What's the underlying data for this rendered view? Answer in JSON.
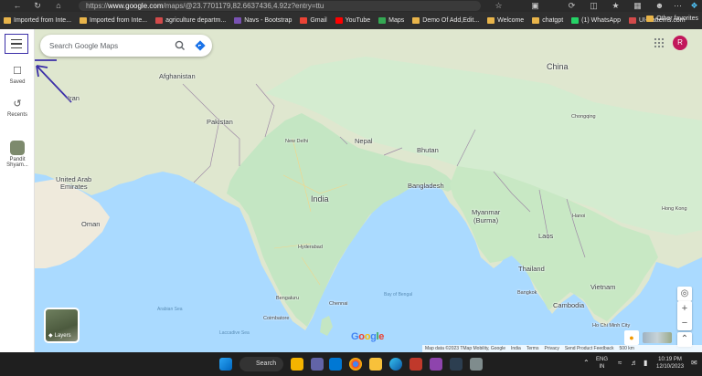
{
  "browser": {
    "url_prefix": "https://",
    "url_host": "www.google.com",
    "url_rest": "/maps/@23.7701179,82.6637436,4.92z?entry=ttu",
    "bookmarks": [
      {
        "label": "Imported from Inte...",
        "color": "#e8b44a"
      },
      {
        "label": "Imported from Inte...",
        "color": "#e8b44a"
      },
      {
        "label": "agriculture departm...",
        "color": "#d24a4a"
      },
      {
        "label": "Navs - Bootstrap",
        "color": "#7952b3"
      },
      {
        "label": "Gmail",
        "color": "#ea4335"
      },
      {
        "label": "YouTube",
        "color": "#ff0000"
      },
      {
        "label": "Maps",
        "color": "#34a853"
      },
      {
        "label": "Demo Of Add,Edit...",
        "color": "#e8b44a"
      },
      {
        "label": "Welcome",
        "color": "#e8b44a"
      },
      {
        "label": "chatgpt",
        "color": "#e8b44a"
      },
      {
        "label": "(1) WhatsApp",
        "color": "#25d366"
      },
      {
        "label": "UI-Patterns.com",
        "color": "#d24a4a"
      }
    ],
    "other_favorites": "Other favorites"
  },
  "maps": {
    "search_placeholder": "Search Google Maps",
    "sidebar": {
      "saved": "Saved",
      "recents": "Recents",
      "place_line1": "Pandit",
      "place_line2": "Shyam..."
    },
    "avatar_letter": "R",
    "layers_label": "Layers",
    "google_logo": "Google",
    "attribution": [
      "Map data ©2023 TMap Mobility, Google",
      "India",
      "Terms",
      "Privacy",
      "Send Product Feedback",
      "500 km"
    ],
    "labels": {
      "countries": [
        "Afghanistan",
        "Pakistan",
        "China",
        "Nepal",
        "Bhutan",
        "Bangladesh",
        "India",
        "Myanmar",
        "(Burma)",
        "Laos",
        "Thailand",
        "Vietnam",
        "Cambodia",
        "United Arab",
        "Emirates",
        "Oman",
        "Iran"
      ],
      "cities": [
        "New Delhi",
        "Hyderabad",
        "Chennai",
        "Bengaluru",
        "Coimbatore",
        "Chongqing",
        "Hong Kong",
        "Hanoi",
        "Bangkok",
        "Ho Chi Minh City"
      ],
      "seas": [
        "Bay of Bengal",
        "Arabian Sea",
        "Laccadive Sea"
      ]
    }
  },
  "taskbar": {
    "search_label": "Search",
    "lang_line1": "ENG",
    "lang_line2": "IN",
    "time": "10:19 PM",
    "date": "12/10/2023"
  }
}
